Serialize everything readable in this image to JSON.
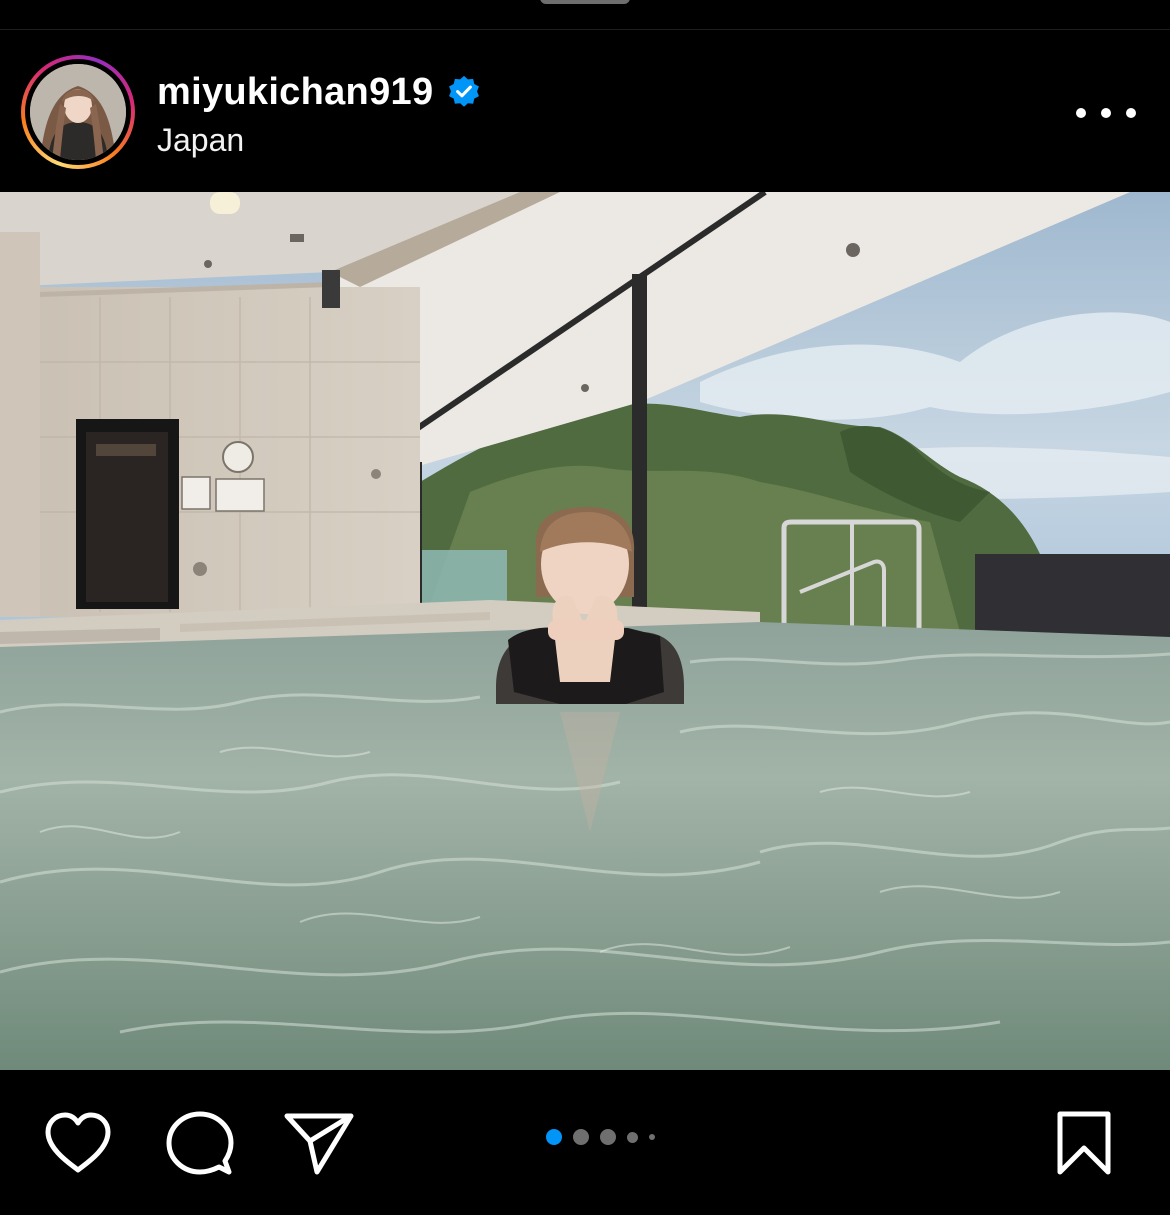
{
  "post": {
    "username": "miyukichan919",
    "verified": true,
    "location": "Japan"
  },
  "media": {
    "current_index": 1,
    "total_count": 5
  },
  "icons": {
    "more": "more-options-icon",
    "verified": "verified-badge-icon",
    "like": "heart-icon",
    "comment": "comment-bubble-icon",
    "share": "paper-plane-icon",
    "save": "bookmark-icon"
  },
  "colors": {
    "background": "#000000",
    "text": "#ffffff",
    "verified_blue": "#0095f6",
    "active_dot": "#0095f6",
    "inactive_dot": "#6f6f6f"
  }
}
